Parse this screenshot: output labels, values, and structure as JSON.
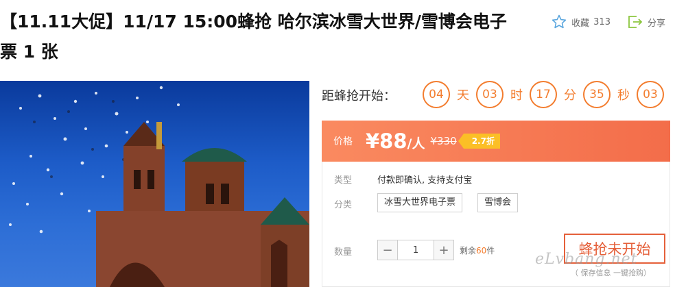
{
  "product": {
    "title": "【11.11大促】11/17 15:00蜂抢 哈尔滨冰雪大世界/雪博会电子票 1 张"
  },
  "toolbar": {
    "favorite_label": "收藏",
    "favorite_count": "313",
    "share_label": "分享"
  },
  "countdown": {
    "label": "距蜂抢开始：",
    "days": "04",
    "days_unit": "天",
    "hours": "03",
    "hours_unit": "时",
    "minutes": "17",
    "minutes_unit": "分",
    "seconds": "35",
    "seconds_unit": "秒",
    "ms": "03"
  },
  "price": {
    "label": "价格",
    "current": "¥88",
    "per": "/人",
    "original": "¥330",
    "discount": "2.7折"
  },
  "details": {
    "type_label": "类型",
    "type_value": "付款即确认, 支持支付宝",
    "category_label": "分类",
    "categories": [
      "冰雪大世界电子票",
      "雪博会"
    ],
    "quantity_label": "数量",
    "quantity_value": "1",
    "stock_prefix": "剩余",
    "stock_count": "60",
    "stock_suffix": "件"
  },
  "buy": {
    "button_label": "蜂抢未开始",
    "subtext": "（ 保存信息  一键抢购）"
  },
  "watermark": "eLvbang.net",
  "colors": {
    "accent": "#f37d2f",
    "price_bar": "#f36d4a",
    "discount_badge": "#fbbf26",
    "buy_border": "#e5603a"
  }
}
